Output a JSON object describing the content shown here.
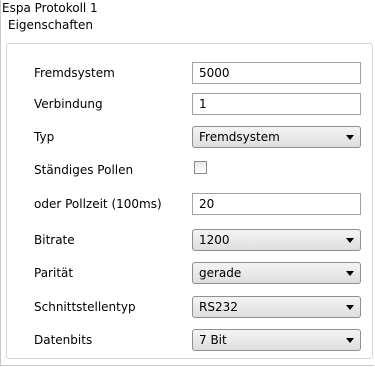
{
  "panel": {
    "title": "Espa Protokoll 1"
  },
  "group": {
    "legend": "Eigenschaften"
  },
  "fields": {
    "fremdsystem": {
      "label": "Fremdsystem",
      "value": "5000"
    },
    "verbindung": {
      "label": "Verbindung",
      "value": "1"
    },
    "typ": {
      "label": "Typ",
      "value": "Fremdsystem"
    },
    "pollen": {
      "label": "Ständiges Pollen",
      "checked": false
    },
    "pollzeit": {
      "label": "oder Pollzeit (100ms)",
      "value": "20"
    },
    "bitrate": {
      "label": "Bitrate",
      "value": "1200"
    },
    "paritaet": {
      "label": "Parität",
      "value": "gerade"
    },
    "schnittstelle": {
      "label": "Schnittstellentyp",
      "value": "RS232"
    },
    "datenbits": {
      "label": "Datenbits",
      "value": "7 Bit"
    }
  },
  "icons": {
    "dropdown": "chevron-down-icon"
  }
}
